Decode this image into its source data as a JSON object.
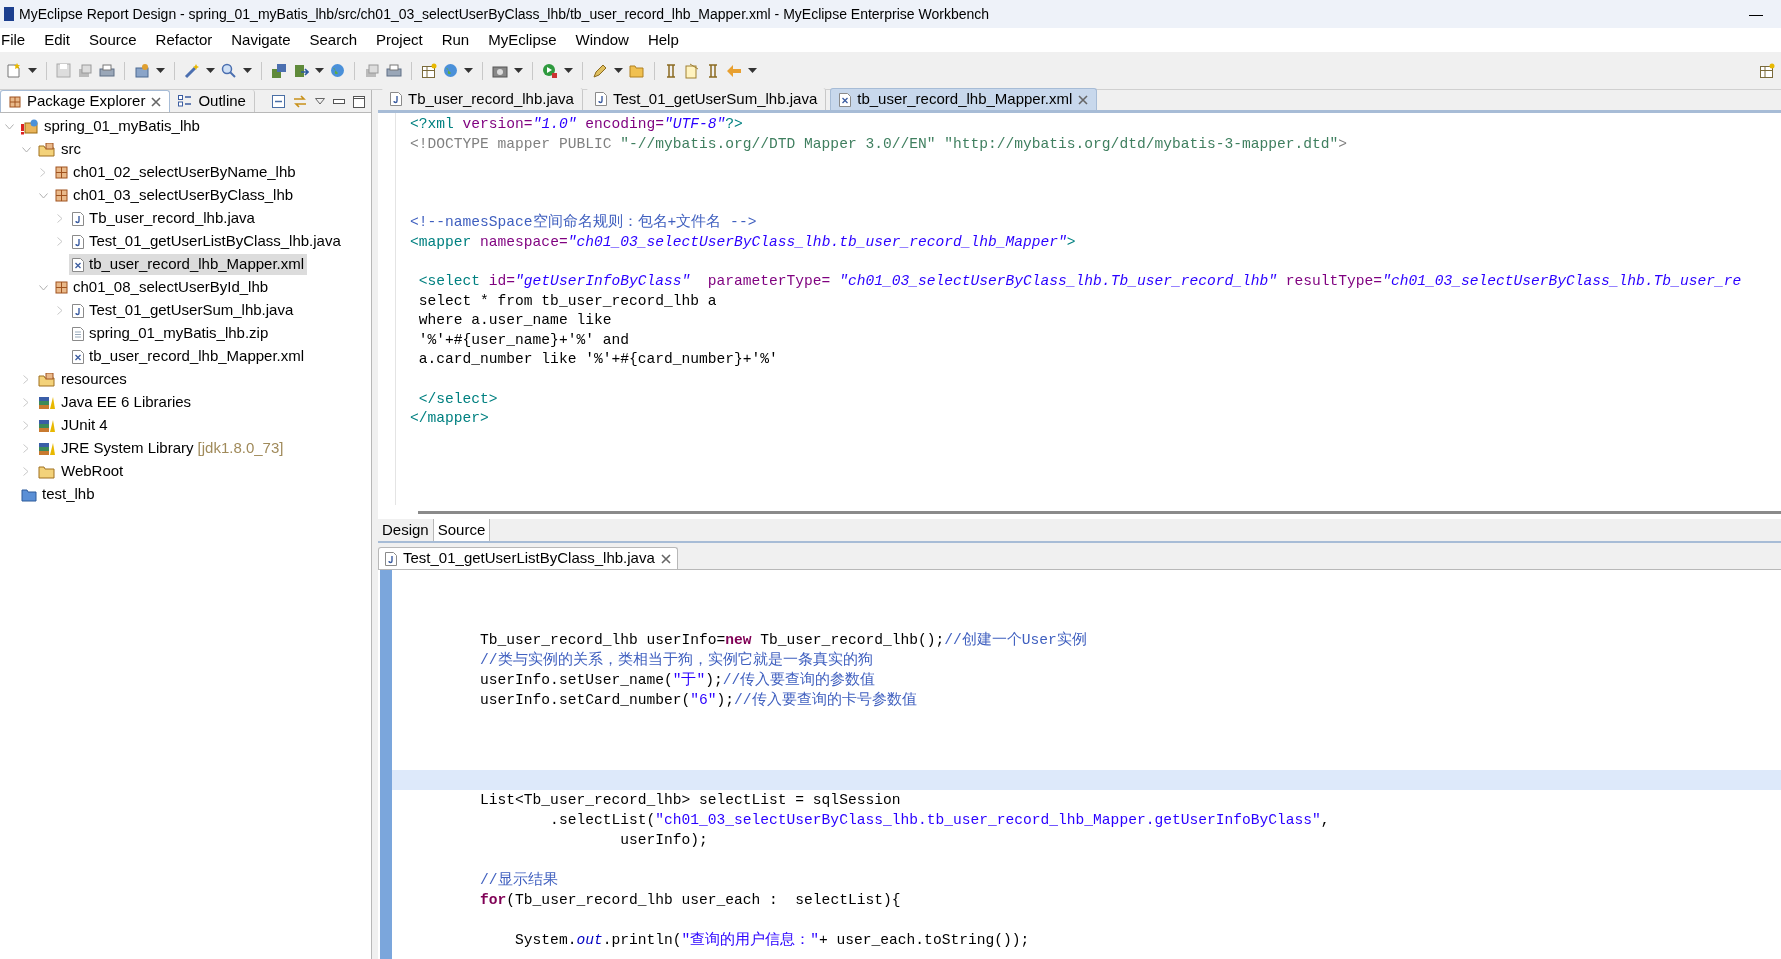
{
  "window": {
    "title": "MyEclipse Report Design - spring_01_myBatis_lhb/src/ch01_03_selectUserByClass_lhb/tb_user_record_lhb_Mapper.xml - MyEclipse Enterprise Workbench",
    "minimize": "—"
  },
  "menu": [
    "File",
    "Edit",
    "Source",
    "Refactor",
    "Navigate",
    "Search",
    "Project",
    "Run",
    "MyEclipse",
    "Window",
    "Help"
  ],
  "side_tabs": [
    {
      "label": "Package Explorer",
      "selected": true,
      "closable": true
    },
    {
      "label": "Outline",
      "selected": false,
      "closable": false
    }
  ],
  "tree": [
    {
      "label": "spring_01_myBatis_lhb",
      "kind": "project",
      "selected": false,
      "expanded": true,
      "children": [
        {
          "label": "src",
          "kind": "source-folder",
          "selected": false,
          "expanded": true,
          "children": [
            {
              "label": "ch01_02_selectUserByName_lhb",
              "kind": "package",
              "selected": false,
              "expanded": false
            },
            {
              "label": "ch01_03_selectUserByClass_lhb",
              "kind": "package",
              "selected": false,
              "expanded": true,
              "children": [
                {
                  "label": "Tb_user_record_lhb.java",
                  "kind": "java",
                  "selected": false,
                  "expanded": false
                },
                {
                  "label": "Test_01_getUserListByClass_lhb.java",
                  "kind": "java",
                  "selected": false,
                  "expanded": false
                },
                {
                  "label": "tb_user_record_lhb_Mapper.xml",
                  "kind": "xml",
                  "selected": true
                }
              ]
            },
            {
              "label": "ch01_08_selectUserById_lhb",
              "kind": "package",
              "selected": false,
              "expanded": true,
              "children": [
                {
                  "label": "Test_01_getUserSum_lhb.java",
                  "kind": "java",
                  "selected": false,
                  "expanded": false
                },
                {
                  "label": "spring_01_myBatis_lhb.zip",
                  "kind": "file",
                  "selected": false
                },
                {
                  "label": "tb_user_record_lhb_Mapper.xml",
                  "kind": "xml",
                  "selected": false
                }
              ]
            }
          ]
        },
        {
          "label": "resources",
          "kind": "source-folder",
          "selected": false,
          "expanded": false
        },
        {
          "label": "Java EE 6 Libraries",
          "kind": "library",
          "selected": false,
          "expanded": false
        },
        {
          "label": "JUnit 4",
          "kind": "library",
          "selected": false,
          "expanded": false
        },
        {
          "label": "JRE System Library",
          "detail": "[jdk1.8.0_73]",
          "kind": "library",
          "selected": false,
          "expanded": false
        },
        {
          "label": "WebRoot",
          "kind": "folder",
          "selected": false,
          "expanded": false
        }
      ]
    },
    {
      "label": "test_lhb",
      "kind": "closed-project",
      "selected": false
    }
  ],
  "editor_tabs": [
    {
      "label": "Tb_user_record_lhb.java",
      "kind": "java",
      "selected": false,
      "closable": false
    },
    {
      "label": "Test_01_getUserSum_lhb.java",
      "kind": "java",
      "selected": false,
      "closable": false
    },
    {
      "label": "tb_user_record_lhb_Mapper.xml",
      "kind": "xml",
      "selected": true,
      "closable": true
    }
  ],
  "xml_lines": [
    {
      "kind": "code",
      "tokens": [
        {
          "kind": "tag",
          "text": "<?xml"
        },
        {
          "kind": "attr",
          "text": " version="
        },
        {
          "kind": "value",
          "text": "\"1.0\""
        },
        {
          "kind": "attr",
          "text": " encoding="
        },
        {
          "kind": "value",
          "text": "\"UTF-8\""
        },
        {
          "kind": "tag",
          "text": "?>"
        }
      ]
    },
    {
      "kind": "code",
      "tokens": [
        {
          "kind": "decl",
          "text": "<!DOCTYPE mapper PUBLIC "
        },
        {
          "kind": "dstring",
          "text": "\"-//mybatis.org//DTD Mapper 3.0//EN\""
        },
        {
          "kind": "dstring",
          "text": " \"http://mybatis.org/dtd/mybatis-3-mapper.dtd\""
        },
        {
          "kind": "decl",
          "text": ">"
        }
      ]
    },
    {
      "kind": "blank"
    },
    {
      "kind": "blank"
    },
    {
      "kind": "blank"
    },
    {
      "kind": "code",
      "tokens": [
        {
          "kind": "comment",
          "text": "<!--namesSpace空间命名规则：包名+文件名 -->"
        }
      ]
    },
    {
      "kind": "code",
      "tokens": [
        {
          "kind": "tag",
          "text": "<mapper"
        },
        {
          "kind": "attr",
          "text": " namespace="
        },
        {
          "kind": "value",
          "text": "\"ch01_03_selectUserByClass_lhb.tb_user_record_lhb_Mapper\""
        },
        {
          "kind": "tag",
          "text": ">"
        }
      ]
    },
    {
      "kind": "blank"
    },
    {
      "kind": "code",
      "tokens": [
        {
          "kind": "tag",
          "text": " <select"
        },
        {
          "kind": "attr",
          "text": " id="
        },
        {
          "kind": "value",
          "text": "\"getUserInfoByClass\""
        },
        {
          "kind": "attr",
          "text": "  parameterType= "
        },
        {
          "kind": "value",
          "text": "\"ch01_03_selectUserByClass_lhb.Tb_user_record_lhb\""
        },
        {
          "kind": "attr",
          "text": " resultType="
        },
        {
          "kind": "value",
          "text": "\"ch01_03_selectUserByClass_lhb.Tb_user_re"
        }
      ]
    },
    {
      "kind": "code",
      "tokens": [
        {
          "kind": "text",
          "text": " select * from tb_user_record_lhb a"
        }
      ]
    },
    {
      "kind": "code",
      "tokens": [
        {
          "kind": "text",
          "text": " where a.user_name like"
        }
      ]
    },
    {
      "kind": "code",
      "tokens": [
        {
          "kind": "text",
          "text": " '%'+#{user_name}+'%' and"
        }
      ]
    },
    {
      "kind": "code",
      "tokens": [
        {
          "kind": "text",
          "text": " a.card_number like '%'+#{card_number}+'%'"
        }
      ]
    },
    {
      "kind": "blank"
    },
    {
      "kind": "code",
      "tokens": [
        {
          "kind": "tag",
          "text": " </select>"
        }
      ]
    },
    {
      "kind": "code",
      "tokens": [
        {
          "kind": "tag",
          "text": "</mapper>"
        }
      ]
    }
  ],
  "view_tabs": [
    {
      "label": "Design",
      "selected": false
    },
    {
      "label": "Source",
      "selected": true
    }
  ],
  "java_tab": {
    "label": "Test_01_getUserListByClass_lhb.java",
    "closable": true
  },
  "java_lines": [
    {
      "kind": "blank",
      "current": false
    },
    {
      "kind": "blank",
      "current": false
    },
    {
      "kind": "code",
      "current": false,
      "tokens": [
        {
          "kind": "text",
          "text": "        Tb_user_record_lhb userInfo="
        },
        {
          "kind": "keyword",
          "text": "new"
        },
        {
          "kind": "text",
          "text": " Tb_user_record_lhb();"
        },
        {
          "kind": "comment",
          "text": "//创建一个User实例"
        }
      ]
    },
    {
      "kind": "code",
      "current": false,
      "tokens": [
        {
          "kind": "comment",
          "text": "        //类与实例的关系，类相当于狗，实例它就是一条真实的狗"
        }
      ]
    },
    {
      "kind": "code",
      "current": false,
      "tokens": [
        {
          "kind": "text",
          "text": "        userInfo.setUser_name("
        },
        {
          "kind": "string",
          "text": "\"于\""
        },
        {
          "kind": "text",
          "text": ");"
        },
        {
          "kind": "comment",
          "text": "//传入要查询的参数值"
        }
      ]
    },
    {
      "kind": "code",
      "current": false,
      "tokens": [
        {
          "kind": "text",
          "text": "        userInfo.setCard_number("
        },
        {
          "kind": "string",
          "text": "\"6\""
        },
        {
          "kind": "text",
          "text": ");"
        },
        {
          "kind": "comment",
          "text": "//传入要查询的卡号参数值"
        }
      ]
    },
    {
      "kind": "blank",
      "current": false
    },
    {
      "kind": "blank",
      "current": false
    },
    {
      "kind": "blank",
      "current": false
    },
    {
      "kind": "blank",
      "current": true
    },
    {
      "kind": "code",
      "current": false,
      "tokens": [
        {
          "kind": "text",
          "text": "        List<Tb_user_record_lhb> selectList = sqlSession"
        }
      ]
    },
    {
      "kind": "code",
      "current": false,
      "tokens": [
        {
          "kind": "text",
          "text": "                .selectList("
        },
        {
          "kind": "string",
          "text": "\"ch01_03_selectUserByClass_lhb.tb_user_record_lhb_Mapper.getUserInfoByClass\""
        },
        {
          "kind": "text",
          "text": ","
        }
      ]
    },
    {
      "kind": "code",
      "current": false,
      "tokens": [
        {
          "kind": "text",
          "text": "                        userInfo);"
        }
      ]
    },
    {
      "kind": "blank",
      "current": false
    },
    {
      "kind": "code",
      "current": false,
      "tokens": [
        {
          "kind": "comment",
          "text": "        //显示结果"
        }
      ]
    },
    {
      "kind": "code",
      "current": false,
      "tokens": [
        {
          "kind": "keyword",
          "text": "        for"
        },
        {
          "kind": "text",
          "text": "(Tb_user_record_lhb user_each :  selectList){"
        }
      ]
    },
    {
      "kind": "blank",
      "current": false
    },
    {
      "kind": "code",
      "current": false,
      "tokens": [
        {
          "kind": "text",
          "text": "            System."
        },
        {
          "kind": "field",
          "text": "out"
        },
        {
          "kind": "text",
          "text": ".println("
        },
        {
          "kind": "string",
          "text": "\"查询的用户信息：\""
        },
        {
          "kind": "text",
          "text": "+ user_each.toString());"
        }
      ]
    }
  ]
}
